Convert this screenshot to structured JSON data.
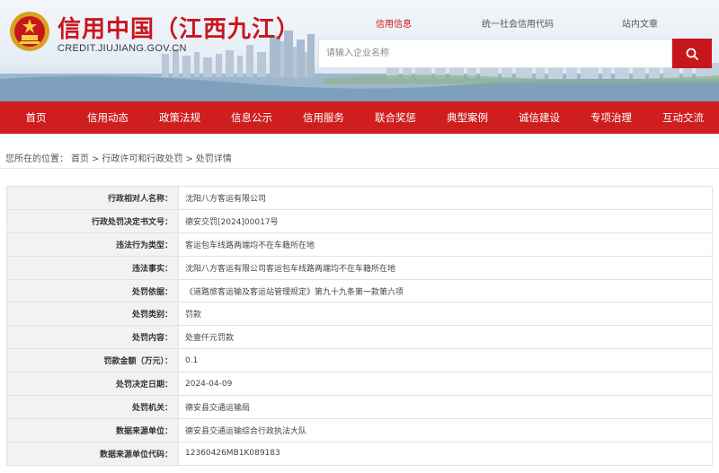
{
  "header": {
    "title": "信用中国（江西九江）",
    "url": "CREDIT.JIUJIANG.GOV.CN"
  },
  "search": {
    "tabs": [
      {
        "label": "信用信息",
        "active": true
      },
      {
        "label": "统一社会信用代码",
        "active": false
      },
      {
        "label": "站内文章",
        "active": false
      }
    ],
    "placeholder": "请输入企业名称",
    "value": ""
  },
  "nav": {
    "items": [
      "首页",
      "信用动态",
      "政策法规",
      "信息公示",
      "信用服务",
      "联合奖惩",
      "典型案例",
      "诚信建设",
      "专项治理",
      "互动交流"
    ]
  },
  "breadcrumb": {
    "prefix": "您所在的位置：",
    "items": [
      "首页",
      "行政许可和行政处罚",
      "处罚详情"
    ],
    "separator": ">"
  },
  "detail": {
    "rows": [
      {
        "label": "行政相对人名称：",
        "value": "沈阳八方客运有限公司"
      },
      {
        "label": "行政处罚决定书文号：",
        "value": "德安交罚[2024]00017号"
      },
      {
        "label": "违法行为类型：",
        "value": "客运包车线路两端均不在车籍所在地"
      },
      {
        "label": "违法事实：",
        "value": "沈阳八方客运有限公司客运包车线路两端均不在车籍所在地"
      },
      {
        "label": "处罚依据：",
        "value": "《道路旅客运输及客运站管理规定》第九十九条第一款第六项"
      },
      {
        "label": "处罚类别：",
        "value": "罚款"
      },
      {
        "label": "处罚内容：",
        "value": "处壹仟元罚款"
      },
      {
        "label": "罚款金额（万元）：",
        "value": "0.1"
      },
      {
        "label": "处罚决定日期：",
        "value": "2024-04-09"
      },
      {
        "label": "处罚机关：",
        "value": "德安县交通运输局"
      },
      {
        "label": "数据来源单位：",
        "value": "德安县交通运输综合行政执法大队"
      },
      {
        "label": "数据来源单位代码：",
        "value": "12360426MB1K089183"
      }
    ]
  },
  "colors": {
    "brand_red": "#c8161d",
    "nav_red": "#cf1e1e"
  },
  "icons": [
    "national-emblem-icon",
    "search-icon"
  ]
}
